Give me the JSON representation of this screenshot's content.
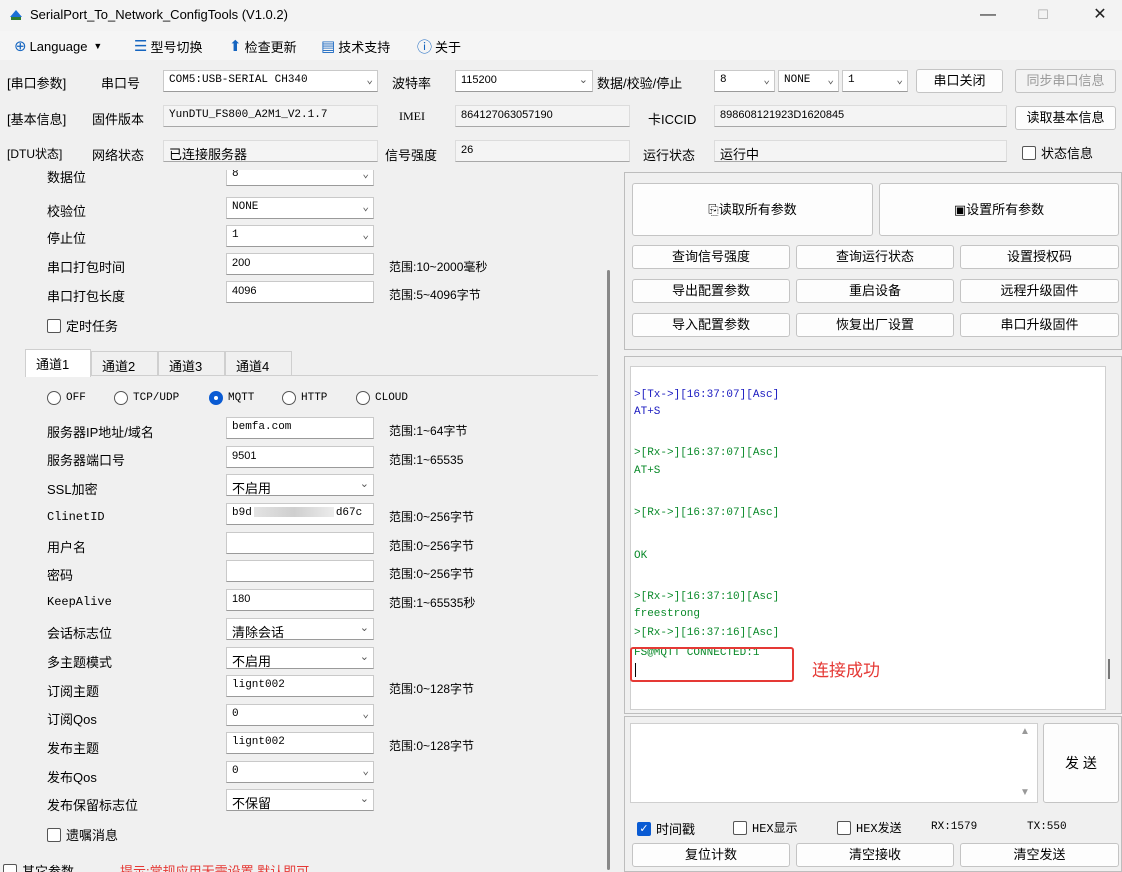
{
  "window": {
    "title": "SerialPort_To_Network_ConfigTools (V1.0.2)",
    "minimize": "—",
    "maximize": "☐",
    "close": "✕"
  },
  "toolbar": {
    "language": "Language",
    "model_switch": "型号切换",
    "check_update": "检查更新",
    "tech_support": "技术支持",
    "about": "关于"
  },
  "serial": {
    "section": "[串口参数]",
    "port_label": "串口号",
    "port_value": "COM5:USB-SERIAL CH340",
    "baud_label": "波特率",
    "baud_value": "115200",
    "dps_label": "数据/校验/停止",
    "data_bits": "8",
    "parity": "NONE",
    "stop_bits": "1",
    "close_button": "串口关闭",
    "sync_button": "同步串口信息"
  },
  "basic": {
    "section": "[基本信息]",
    "fw_label": "固件版本",
    "fw_value": "YunDTU_FS800_A2M1_V2.1.7",
    "imei_label": "IMEI",
    "imei_value": "864127063057190",
    "iccid_label": "卡ICCID",
    "iccid_value": "898608121923D1620845",
    "read_button": "读取基本信息"
  },
  "dtu": {
    "section": "[DTU状态]",
    "net_label": "网络状态",
    "net_value": "已连接服务器",
    "signal_label": "信号强度",
    "signal_value": "26",
    "run_label": "运行状态",
    "run_value": "运行中",
    "status_info": "状态信息"
  },
  "uart": {
    "data_bits_label": "数据位",
    "data_bits_value": "8",
    "parity_label": "校验位",
    "parity_value": "NONE",
    "stop_label": "停止位",
    "stop_value": "1",
    "pack_time_label": "串口打包时间",
    "pack_time_value": "200",
    "pack_time_range": "范围:10~2000毫秒",
    "pack_len_label": "串口打包长度",
    "pack_len_value": "4096",
    "pack_len_range": "范围:5~4096字节",
    "timed_task": "定时任务"
  },
  "channel_tabs": [
    "通道1",
    "通道2",
    "通道3",
    "通道4"
  ],
  "protocols": [
    "OFF",
    "TCP/UDP",
    "MQTT",
    "HTTP",
    "CLOUD"
  ],
  "mqtt": {
    "server_label": "服务器IP地址/域名",
    "server_value": "bemfa.com",
    "server_range": "范围:1~64字节",
    "port_label": "服务器端口号",
    "port_value": "9501",
    "port_range": "范围:1~65535",
    "ssl_label": "SSL加密",
    "ssl_value": "不启用",
    "clientid_label": "ClinetID",
    "clientid_start": "b9d",
    "clientid_end": "d67c",
    "clientid_range": "范围:0~256字节",
    "user_label": "用户名",
    "user_value": "",
    "user_range": "范围:0~256字节",
    "pwd_label": "密码",
    "pwd_value": "",
    "pwd_range": "范围:0~256字节",
    "keepalive_label": "KeepAlive",
    "keepalive_value": "180",
    "keepalive_range": "范围:1~65535秒",
    "session_label": "会话标志位",
    "session_value": "清除会话",
    "multi_label": "多主题模式",
    "multi_value": "不启用",
    "sub_label": "订阅主题",
    "sub_value": "lignt002",
    "sub_range": "范围:0~128字节",
    "subqos_label": "订阅Qos",
    "subqos_value": "0",
    "pub_label": "发布主题",
    "pub_value": "lignt002",
    "pub_range": "范围:0~128字节",
    "pubqos_label": "发布Qos",
    "pubqos_value": "0",
    "retain_label": "发布保留标志位",
    "retain_value": "不保留",
    "will_label": "遗嘱消息"
  },
  "other": {
    "label": "其它参数",
    "hint": "提示:常规应用无需设置,默认即可"
  },
  "actions": {
    "read_all": "读取所有参数",
    "set_all": "设置所有参数",
    "q_signal": "查询信号强度",
    "q_run": "查询运行状态",
    "set_auth": "设置授权码",
    "export": "导出配置参数",
    "reboot": "重启设备",
    "remote_upgrade": "远程升级固件",
    "import": "导入配置参数",
    "factory": "恢复出厂设置",
    "serial_upgrade": "串口升级固件"
  },
  "log": [
    {
      "text": ">[Tx->][16:37:07][Asc]",
      "kind": "tx"
    },
    {
      "text": "AT+S",
      "kind": "tx"
    },
    {
      "text": ">[Rx->][16:37:07][Asc]",
      "kind": "rx"
    },
    {
      "text": "AT+S",
      "kind": "rx"
    },
    {
      "text": ">[Rx->][16:37:07][Asc]",
      "kind": "rx"
    },
    {
      "text": "OK",
      "kind": "rx"
    },
    {
      "text": ">[Rx->][16:37:10][Asc]",
      "kind": "rx"
    },
    {
      "text": "freestrong",
      "kind": "rx"
    },
    {
      "text": ">[Rx->][16:37:16][Asc]",
      "kind": "rx"
    },
    {
      "text": "FS@MQTT CONNECTED:1",
      "kind": "rx"
    }
  ],
  "annotation": "连接成功",
  "send": {
    "send_button": "发 送",
    "timestamp": "时间戳",
    "hex_display": "HEX显示",
    "hex_send": "HEX发送",
    "rx_count": "RX:1579",
    "tx_count": "TX:550",
    "reset_count": "复位计数",
    "clear_rx": "清空接收",
    "clear_tx": "清空发送"
  },
  "colors": {
    "accent": "#0a5bd3",
    "tx": "#1a1ac0",
    "rx": "#0a8a2a",
    "annotation": "#e53935"
  }
}
